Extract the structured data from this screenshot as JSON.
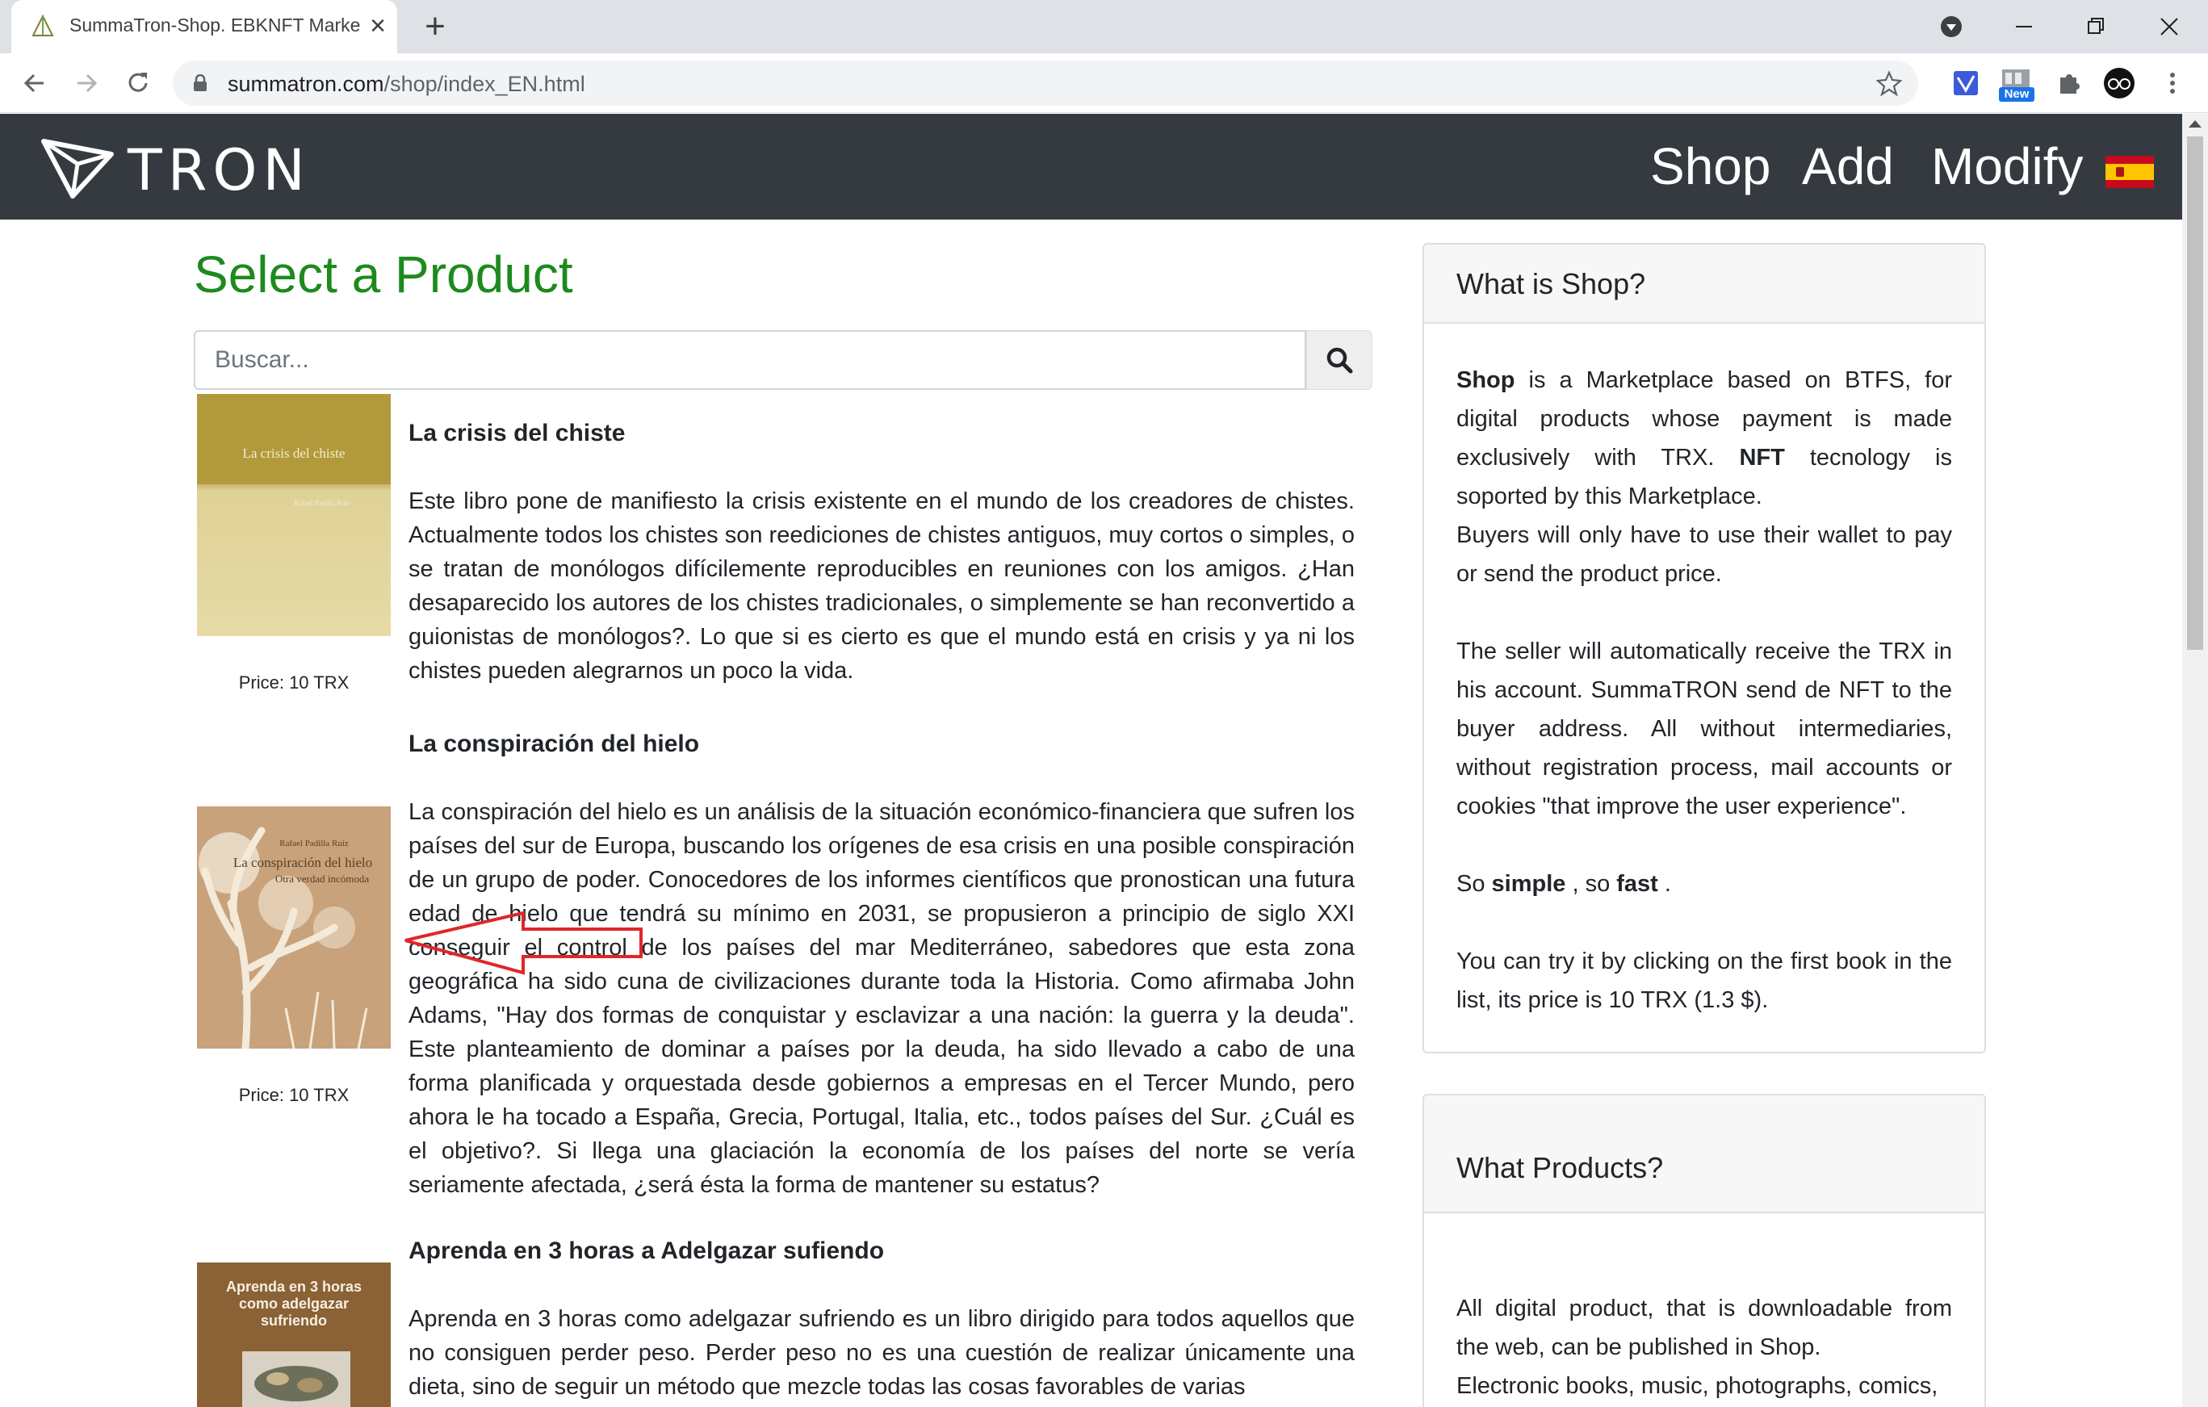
{
  "browser": {
    "tab_title": "SummaTron-Shop. EBKNFT Marketplace",
    "tab_close": "×",
    "new_tab": "+",
    "url_host": "summatron.com",
    "url_path": "/shop/index_EN.html",
    "extension_badge": "New"
  },
  "navbar": {
    "logo_text": "TRON",
    "links": [
      "Shop",
      "Add",
      "Modify"
    ],
    "language_flag": "es-flag"
  },
  "main": {
    "heading": "Select a Product",
    "search_placeholder": "Buscar...",
    "products": [
      {
        "title": "La crisis del chiste",
        "cover_title": "La crisis del chiste",
        "cover_author": "Rafael Padilla Ruiz",
        "price": "Price: 10 TRX",
        "description": "Este libro pone de manifiesto la crisis existente en el mundo de los creadores de chistes. Actualmente todos los chistes son reediciones de chistes antiguos, muy cortos o simples, o se tratan de monólogos difícilemente reproducibles en reuniones con los amigos. ¿Han desaparecido los autores de los chistes tradicionales, o simplemente se han reconvertido a guionistas de monólogos?. Lo que si es cierto es que el mundo está en crisis y ya ni los chistes pueden alegrarnos un poco la vida."
      },
      {
        "title": "La conspiración del hielo",
        "cover_author": "Rafael Padilla Ruiz",
        "cover_title": "La conspiración del hielo",
        "cover_subtitle": "Otra verdad incómoda",
        "price": "Price: 10 TRX",
        "description": "La conspiración del hielo es un análisis de la situación económico-financiera que sufren los países del sur de Europa, buscando los orígenes de esa crisis en una posible conspiración de un grupo de poder. Conocedores de los informes científicos que pronostican una futura edad de hielo que tendrá su mínimo en 2031, se propusieron a principio de siglo XXI conseguir el control de los países del mar Mediterráneo, sabedores que esta zona geográfica ha sido cuna de civilizaciones durante toda la Historia. Como afirmaba John Adams, \"Hay dos formas de conquistar y esclavizar a una nación: la guerra y la deuda\". Este planteamiento de dominar a países por la deuda, ha sido llevado a cabo de una forma planificada y orquestada desde gobiernos a empresas en el Tercer Mundo, pero ahora le ha tocado a España, Grecia, Portugal, Italia, etc., todos países del Sur. ¿Cuál es el objetivo?. Si llega una glaciación la economía de los países del norte se vería seriamente afectada, ¿será ésta la forma de mantener su estatus?"
      },
      {
        "title": "Aprenda en 3 horas a Adelgazar sufiendo",
        "cover_title": "Aprenda en 3 horas como adelgazar sufriendo",
        "description": "Aprenda en 3 horas como adelgazar sufriendo es un libro dirigido para todos aquellos que no consiguen perder peso. Perder peso no es una cuestión de realizar únicamente una dieta, sino de seguir un método que mezcle todas las cosas favorables de varias"
      }
    ]
  },
  "sidebar": {
    "what_is_shop": {
      "header": "What is Shop?",
      "p1_bold": "Shop",
      "p1_a": " is a Marketplace based on BTFS, for digital products whose payment is made exclusively with TRX. ",
      "p1_bold2": "NFT",
      "p1_b": " tecnology is soported by this Marketplace.",
      "p2": "Buyers will only have to use their wallet to pay or send the product price.",
      "p3": "The seller will automatically receive the TRX in his account. SummaTRON send de NFT to the buyer address. All without intermediaries, without registration process, mail accounts or cookies \"that improve the user experience\".",
      "p4_a": "So ",
      "p4_bold1": "simple",
      "p4_b": " , so ",
      "p4_bold2": "fast",
      "p4_c": " .",
      "p5": "You can try it by clicking on the first book in the list, its price is 10 TRX (1.3 $)."
    },
    "what_products": {
      "header": "What Products?",
      "p1": "All digital product, that is downloadable from the web, can be published in Shop.",
      "p2": "Electronic books, music, photographs, comics,"
    }
  },
  "colors": {
    "navbar_bg": "#343a40",
    "heading_green": "#1d8a1d",
    "annotation_red": "#e0262a"
  }
}
